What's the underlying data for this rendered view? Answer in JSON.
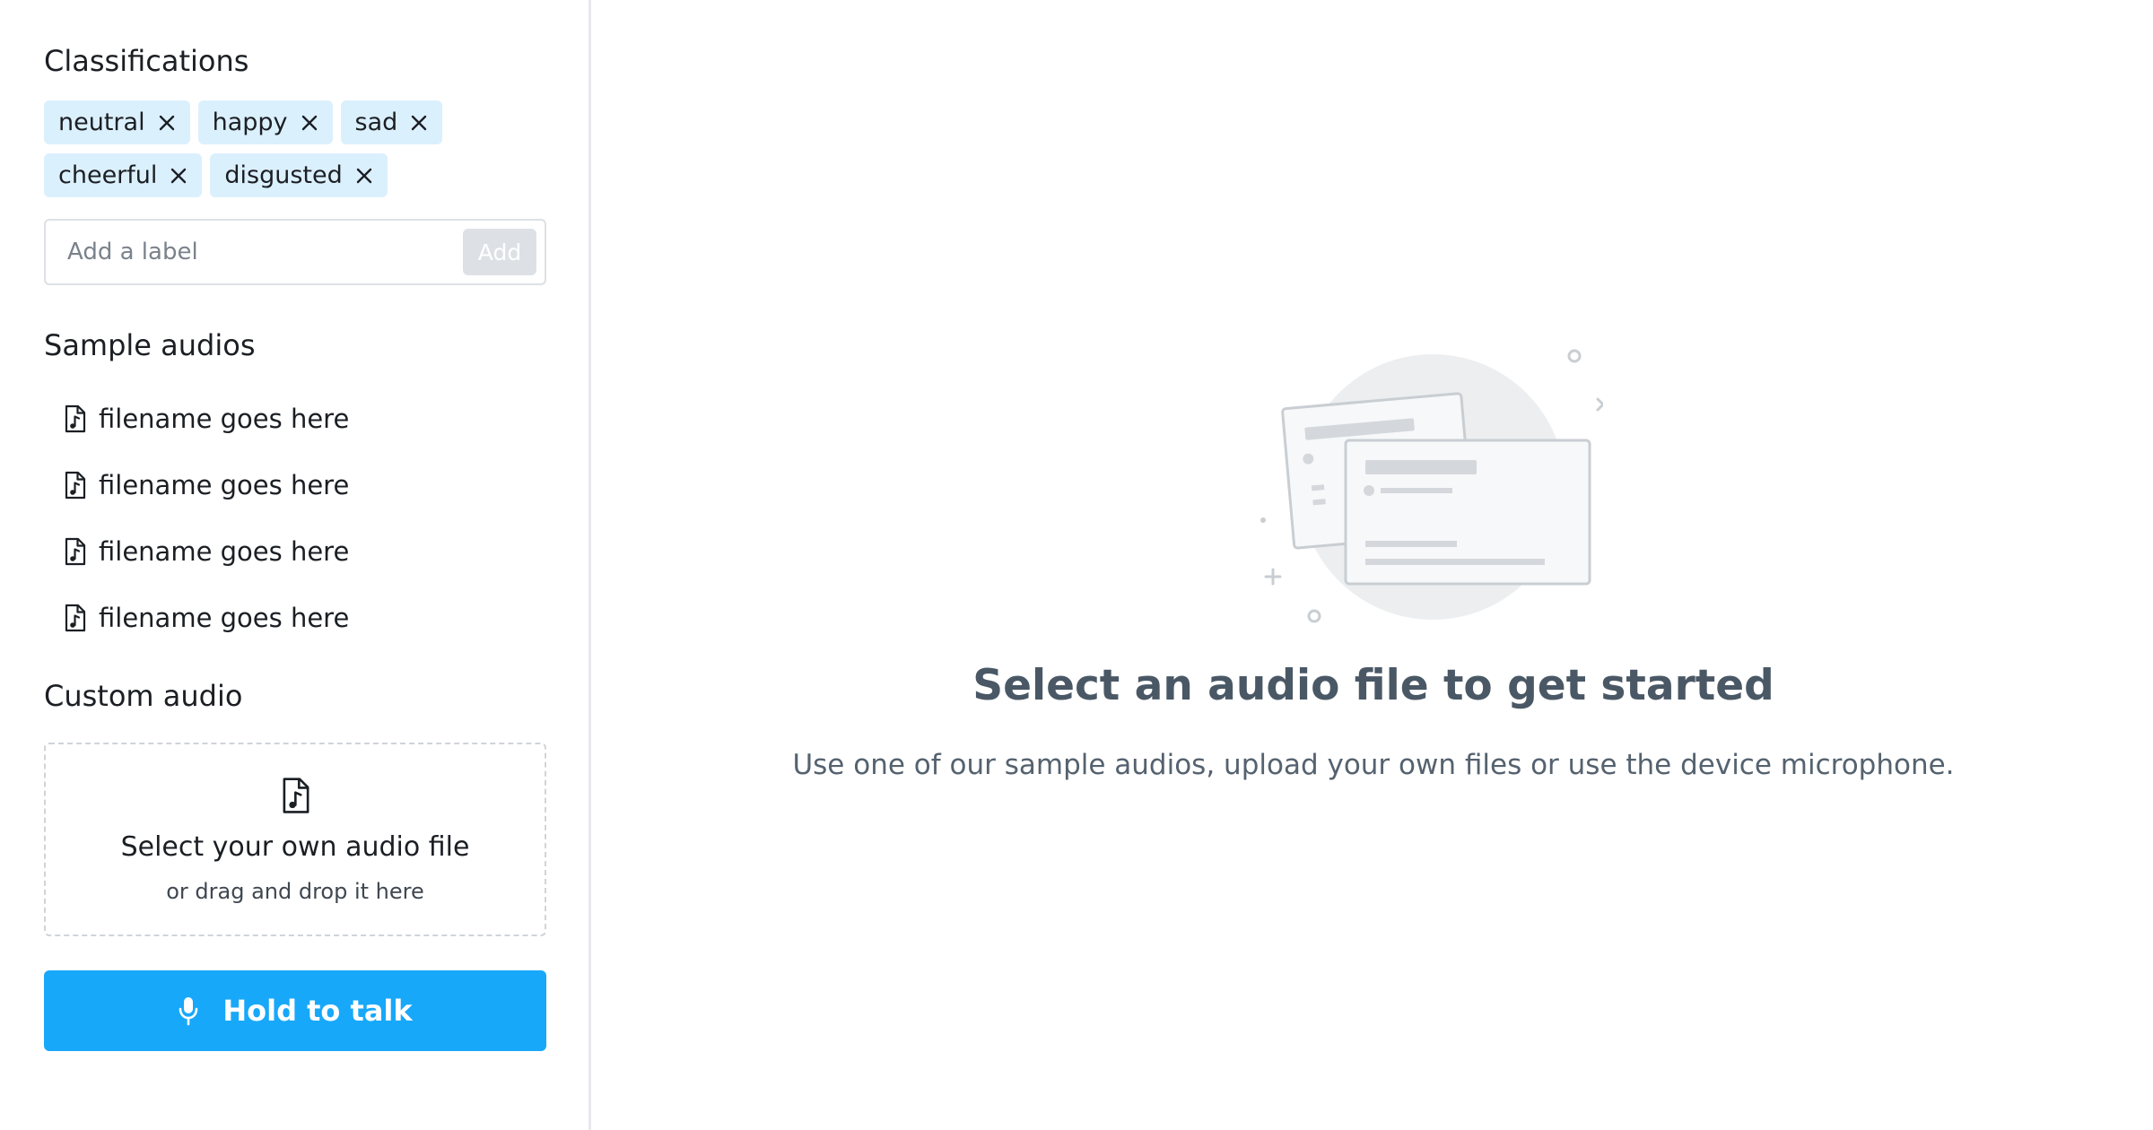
{
  "sidebar": {
    "classifications_title": "Classifications",
    "labels": [
      "neutral",
      "happy",
      "sad",
      "cheerful",
      "disgusted"
    ],
    "add_label_placeholder": "Add a label",
    "add_button": "Add",
    "sample_audios_title": "Sample audios",
    "sample_files": [
      "filename goes here",
      "filename goes here",
      "filename goes here",
      "filename goes here"
    ],
    "custom_audio_title": "Custom audio",
    "dropzone": {
      "title": "Select your own audio file",
      "subtitle": "or drag and drop it here"
    },
    "talk_button": "Hold to talk"
  },
  "main": {
    "empty_title": "Select an audio file to get started",
    "empty_subtitle": "Use one of our sample audios, upload your own files or use the device microphone."
  },
  "icons": {
    "chip_remove": "close-icon",
    "file": "audio-file-icon",
    "microphone": "microphone-icon"
  },
  "colors": {
    "chip_bg": "#dbf0fd",
    "primary": "#18a8fa",
    "heading": "#4a5866"
  }
}
